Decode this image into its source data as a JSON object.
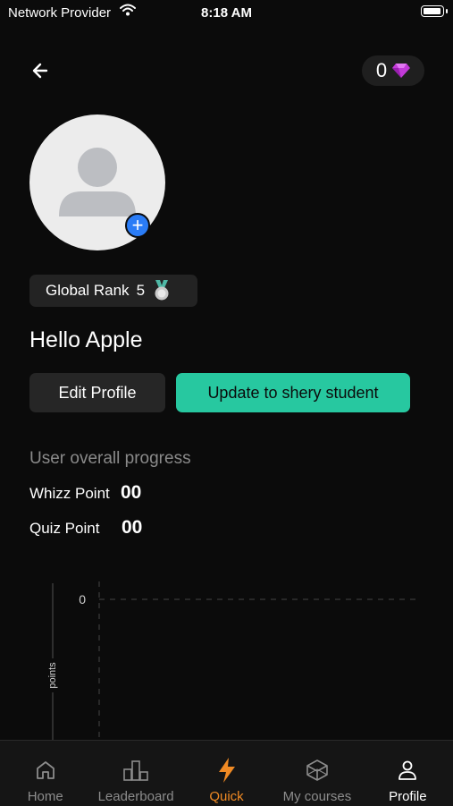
{
  "status_bar": {
    "carrier": "Network Provider",
    "time": "8:18 AM",
    "battery_level": 1.0
  },
  "header": {
    "back_icon": "arrow-left-icon",
    "gem_count": "0",
    "gem_icon": "gem-icon",
    "gem_color": "#c23ad8"
  },
  "profile": {
    "avatar_icon": "user-placeholder-icon",
    "add_photo_icon": "plus-icon",
    "rank_label": "Global Rank",
    "rank_value": "5",
    "rank_icon": "medal-icon",
    "greeting": "Hello Apple",
    "edit_label": "Edit Profile",
    "upgrade_label": "Update to shery student"
  },
  "progress": {
    "title": "User overall progress",
    "whizz_label": "Whizz Point",
    "whizz_value": "00",
    "quiz_label": "Quiz Point",
    "quiz_value": "00"
  },
  "chart_data": {
    "type": "line",
    "ylabel": "points",
    "y_ticks": [
      "0"
    ],
    "values": [],
    "grid": "dashed"
  },
  "tabbar": {
    "items": [
      {
        "label": "Home",
        "icon": "home-icon"
      },
      {
        "label": "Leaderboard",
        "icon": "leaderboard-icon"
      },
      {
        "label": "Quick",
        "icon": "lightning-icon",
        "active": true
      },
      {
        "label": "My courses",
        "icon": "courses-icon"
      },
      {
        "label": "Profile",
        "icon": "profile-icon",
        "selected": true
      }
    ]
  },
  "colors": {
    "accent": "#27c8a0",
    "quick_tab": "#f08a24",
    "add_photo": "#2a7cf6"
  }
}
